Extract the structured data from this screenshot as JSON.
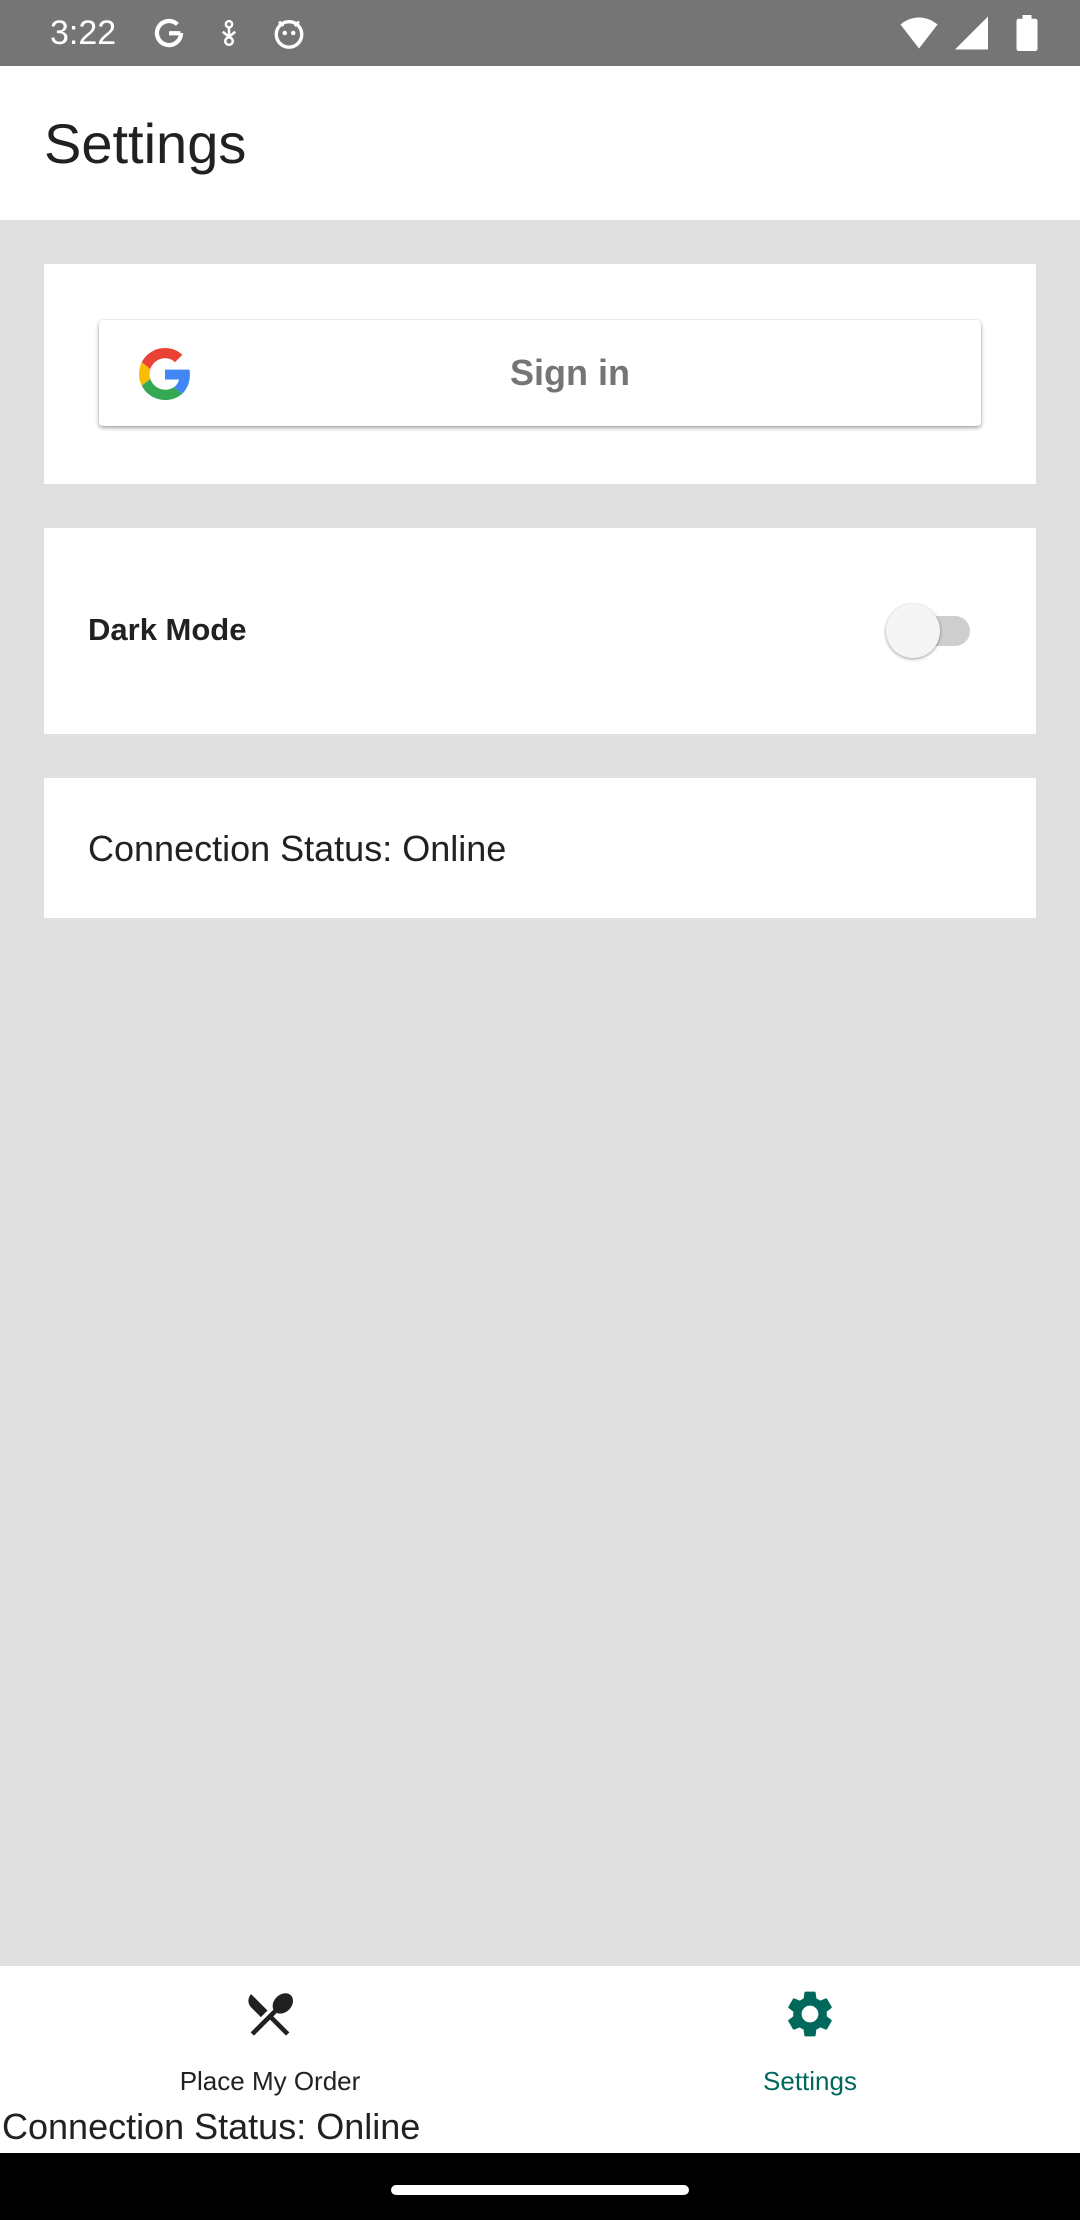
{
  "status_bar": {
    "time": "3:22",
    "left_icons": [
      "google-g-icon",
      "usb-debug-icon",
      "android-face-icon"
    ],
    "right_icons": [
      "wifi-icon",
      "cell-signal-icon",
      "battery-icon"
    ]
  },
  "app_bar": {
    "title": "Settings"
  },
  "signin": {
    "label": "Sign in",
    "icon": "google-logo-icon"
  },
  "dark_mode": {
    "label": "Dark Mode",
    "enabled": false
  },
  "connection": {
    "text": "Connection Status: Online"
  },
  "bottom_nav": {
    "items": [
      {
        "label": "Place My Order",
        "icon": "fork-knife-icon",
        "active": false
      },
      {
        "label": "Settings",
        "icon": "gear-icon",
        "active": true
      }
    ]
  },
  "footer": {
    "status_text": "Connection Status: Online"
  },
  "colors": {
    "accent": "#00695c",
    "status_bar": "#757575",
    "background": "#e0e0e0",
    "card": "#ffffff",
    "signin_text": "#757575"
  }
}
